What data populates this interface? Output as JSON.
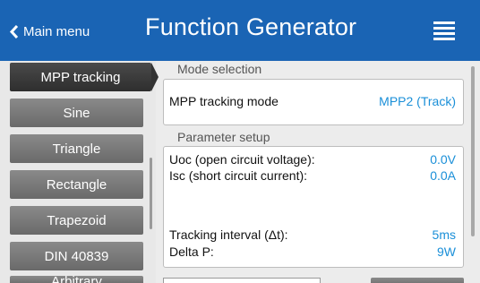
{
  "header": {
    "back_label": "Main menu",
    "title": "Function Generator"
  },
  "sidebar": {
    "items": [
      {
        "label": "MPP tracking",
        "active": true
      },
      {
        "label": "Sine"
      },
      {
        "label": "Triangle"
      },
      {
        "label": "Rectangle"
      },
      {
        "label": "Trapezoid"
      },
      {
        "label": "DIN 40839"
      },
      {
        "label": "Arbitrary"
      }
    ]
  },
  "mode_selection": {
    "group_label": "Mode selection",
    "label": "MPP tracking mode",
    "value": "MPP2 (Track)"
  },
  "parameter_setup": {
    "group_label": "Parameter setup",
    "uoc": {
      "label": "Uoc (open circuit voltage):",
      "value": "0.0V"
    },
    "isc": {
      "label": "Isc (short circuit current):",
      "value": "0.0A"
    },
    "interval": {
      "label": "Tracking interval (Δt):",
      "value": "5ms"
    },
    "delta_p": {
      "label": "Delta P:",
      "value": "9W"
    }
  },
  "colors": {
    "header": "#1a64b4",
    "value": "#1a8fd8",
    "active_tab": "#333333"
  }
}
